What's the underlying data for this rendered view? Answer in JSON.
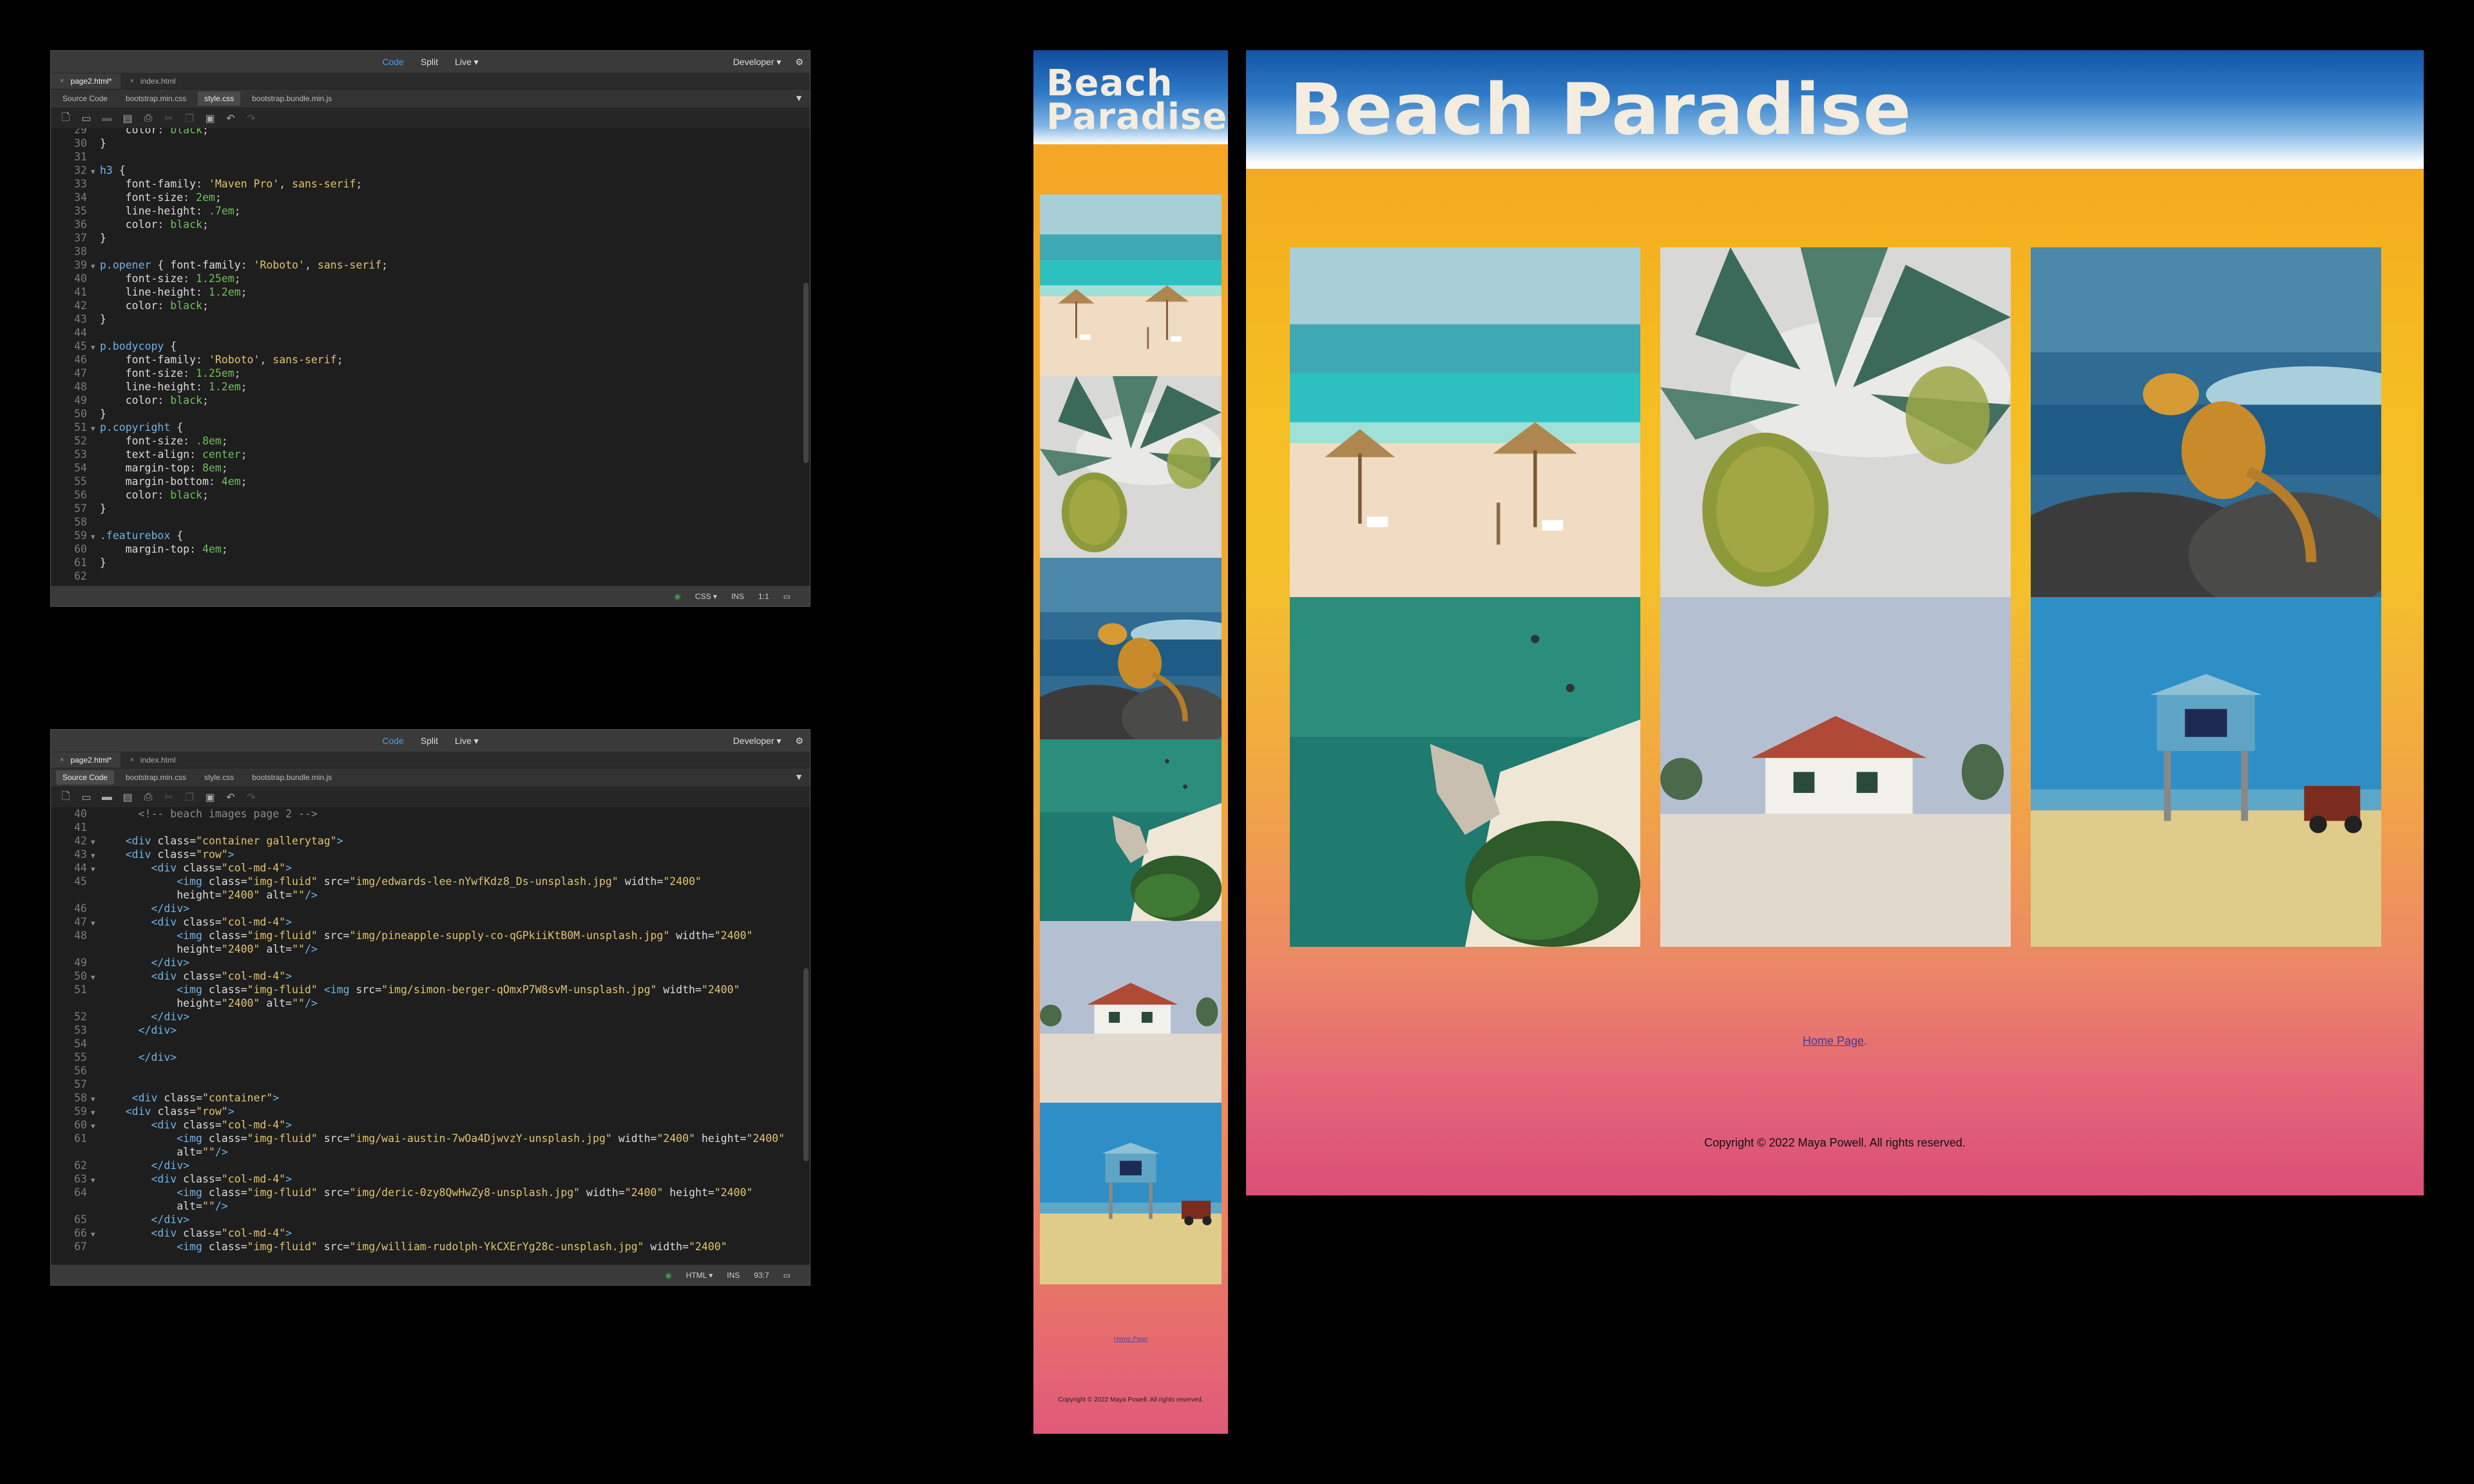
{
  "editor": {
    "views": [
      "Code",
      "Split",
      "Live"
    ],
    "active_view": "Code",
    "workspace": "Developer",
    "files": [
      "page2.html*",
      "index.html"
    ],
    "related": [
      "Source Code",
      "bootstrap.min.css",
      "style.css",
      "bootstrap.bundle.min.js"
    ]
  },
  "css_editor": {
    "active_related": "style.css",
    "status": {
      "language": "CSS",
      "mode": "INS",
      "position": "1:1"
    }
  },
  "html_editor": {
    "active_related": "Source Code",
    "status": {
      "language": "HTML",
      "mode": "INS",
      "position": "93:7"
    }
  },
  "site": {
    "title": "Beach Paradise",
    "home_link": "Home Page",
    "home_suffix": ".",
    "copyright": "Copyright © 2022 Maya Powell. All rights reserved.",
    "images": [
      {
        "name": "beach-umbrellas-image",
        "desc": "beach"
      },
      {
        "name": "pineapple-image",
        "desc": "pineapple"
      },
      {
        "name": "iguana-image",
        "desc": "iguana"
      },
      {
        "name": "aerial-coast-image",
        "desc": "coast"
      },
      {
        "name": "beach-house-image",
        "desc": "house"
      },
      {
        "name": "lifeguard-tower-image",
        "desc": "tower"
      }
    ],
    "colors": {
      "orange": "#f4a623",
      "pink": "#db4f78",
      "blue": "#1355a6"
    }
  }
}
